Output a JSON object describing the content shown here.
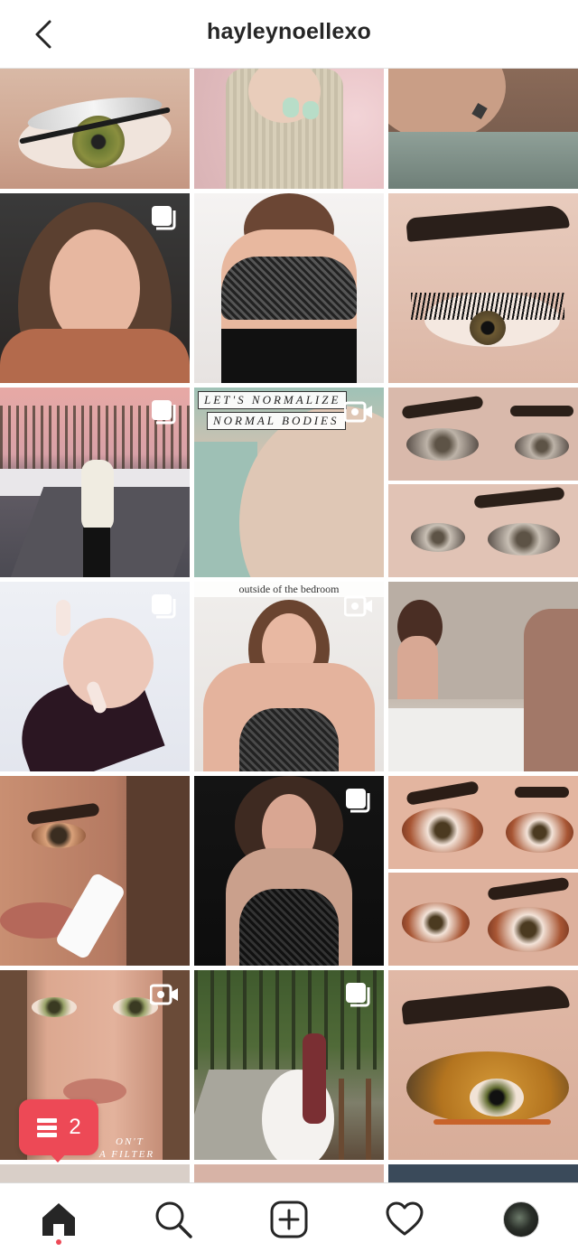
{
  "header": {
    "title": "hayleynoellexo",
    "back_icon": "chevron-left-icon"
  },
  "grid": {
    "posts": [
      {
        "label": "eye-makeup-silver-glitter",
        "badge": null
      },
      {
        "label": "nails-sweater-closeup",
        "badge": null
      },
      {
        "label": "back-tattoo-closeup",
        "badge": null
      },
      {
        "label": "selfie-car",
        "badge": "carousel"
      },
      {
        "label": "lingerie-mirror",
        "badge": null
      },
      {
        "label": "eyebrow-lashes-closeup",
        "badge": null
      },
      {
        "label": "sunset-road-outfit",
        "badge": "carousel"
      },
      {
        "label": "normalize-normal-bodies-video",
        "badge": "video",
        "overlay_line1": "LET'S NORMALIZE",
        "overlay_line2": "NORMAL BODIES"
      },
      {
        "label": "smokey-eye-split",
        "badge": null
      },
      {
        "label": "nails-hand",
        "badge": "carousel"
      },
      {
        "label": "outside-of-bedroom-video",
        "badge": "video",
        "caption": "outside of the bedroom"
      },
      {
        "label": "bathroom-mirror",
        "badge": null
      },
      {
        "label": "skincare-kopari",
        "badge": null
      },
      {
        "label": "black-lingerie-dark",
        "badge": "carousel"
      },
      {
        "label": "cut-crease-split",
        "badge": null
      },
      {
        "label": "no-filter-video",
        "badge": "video",
        "caption_a": "ON'T",
        "caption_b": "A FILTER"
      },
      {
        "label": "wedding-forest",
        "badge": "carousel"
      },
      {
        "label": "gold-glitter-eye",
        "badge": null
      }
    ]
  },
  "notification": {
    "count": "2",
    "icon": "activity-list-icon",
    "color": "#ed4956"
  },
  "bottom_nav": {
    "items": [
      {
        "name": "home",
        "icon": "home-icon",
        "active": true
      },
      {
        "name": "search",
        "icon": "search-icon",
        "active": false
      },
      {
        "name": "create",
        "icon": "plus-square-icon",
        "active": false
      },
      {
        "name": "activity",
        "icon": "heart-icon",
        "active": false
      },
      {
        "name": "profile",
        "icon": "profile-avatar",
        "active": false
      }
    ]
  }
}
